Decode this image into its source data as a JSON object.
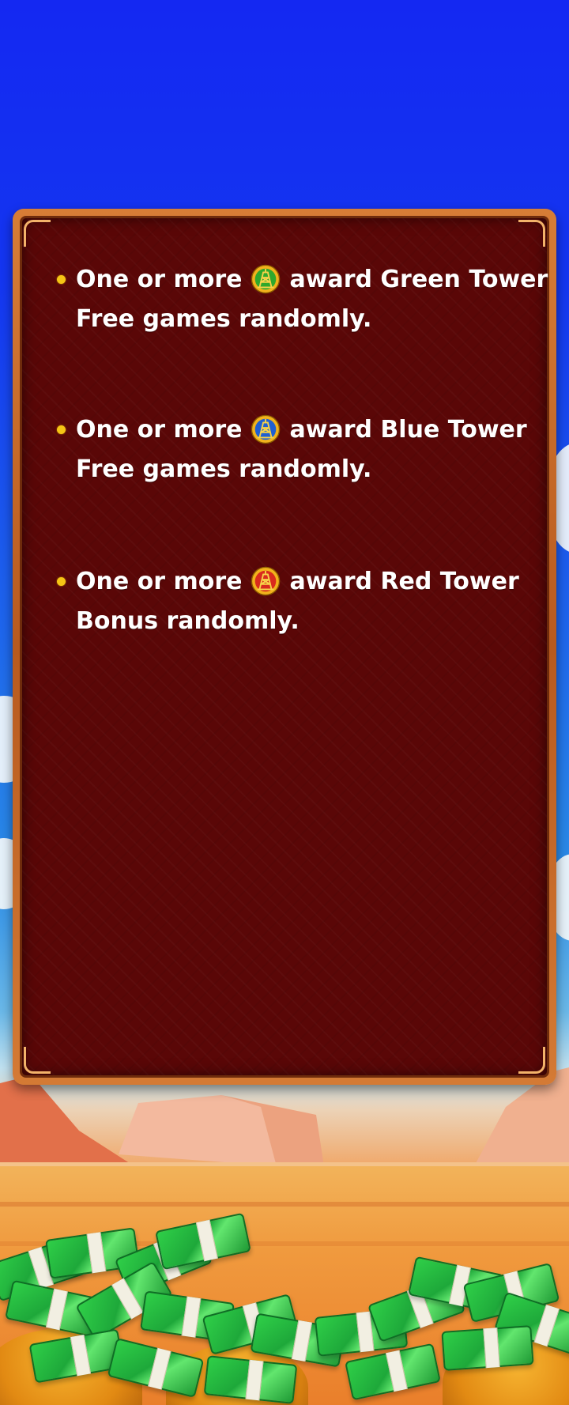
{
  "rules": [
    {
      "prefix": "One or more",
      "suffix": "award Green Tower",
      "line2": "Free games randomly.",
      "icon": "green-tower-icon",
      "icon_color": "#2fa82c"
    },
    {
      "prefix": "One or more",
      "suffix": "award Blue Tower",
      "line2": "Free games randomly.",
      "icon": "blue-tower-icon",
      "icon_color": "#1f5fd1"
    },
    {
      "prefix": "One or more",
      "suffix": "award Red Tower",
      "line2": "Bonus randomly.",
      "icon": "red-tower-icon",
      "icon_color": "#d92b1d"
    }
  ],
  "colors": {
    "panel_bg": "#5a0707",
    "panel_frame": "#c96a28",
    "bullet": "#f5c515",
    "text": "#ffffff"
  }
}
